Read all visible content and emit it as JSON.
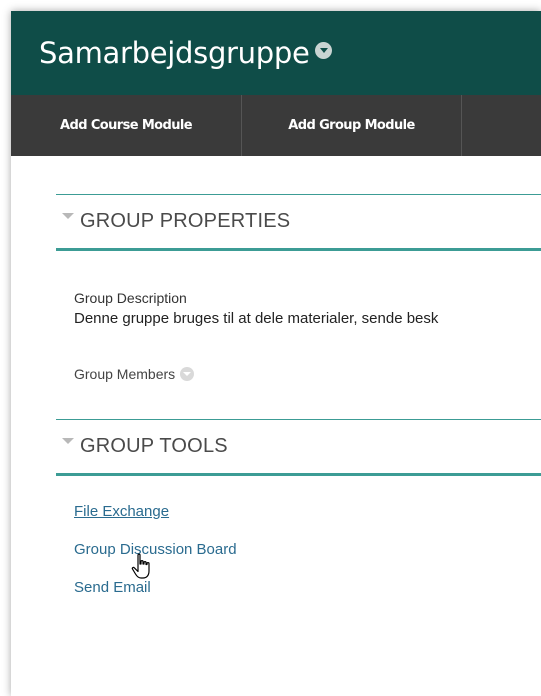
{
  "header": {
    "title": "Samarbejdsgruppe"
  },
  "module_bar": {
    "add_course_module": "Add Course Module",
    "add_group_module": "Add Group Module"
  },
  "group_properties": {
    "title": "GROUP PROPERTIES",
    "description_label": "Group Description",
    "description_text": "Denne gruppe bruges til at dele materialer, sende besk",
    "members_label": "Group Members"
  },
  "group_tools": {
    "title": "GROUP TOOLS",
    "links": [
      {
        "label": "File Exchange"
      },
      {
        "label": "Group Discussion Board"
      },
      {
        "label": "Send Email"
      }
    ]
  },
  "colors": {
    "header_bg": "#0f4d48",
    "module_bar_bg": "#3a3a3a",
    "accent_teal": "#3c9c95",
    "link": "#2a6b8f"
  },
  "icons": {
    "title_menu": "chevron-circle-down-icon",
    "members_menu": "chevron-circle-down-icon",
    "section_toggle": "caret-down-icon",
    "cursor": "hand-pointer-icon"
  }
}
